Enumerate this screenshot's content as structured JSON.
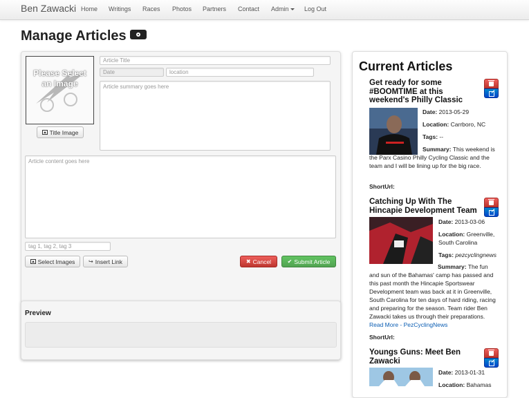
{
  "nav": {
    "brand": "Ben Zawacki",
    "items": [
      "Home",
      "Writings",
      "Races",
      "Photos",
      "Partners",
      "Contact",
      "Admin",
      "Log Out"
    ]
  },
  "page": {
    "title": "Manage Articles"
  },
  "form": {
    "title_image_text": "Please Select an Image",
    "title_image_button": "Title Image",
    "article_title_placeholder": "Article Title",
    "date_placeholder": "Date",
    "location_placeholder": "location",
    "summary_placeholder": "Article summary goes here",
    "content_placeholder": "Article content goes here",
    "tags_placeholder": "tag 1, tag 2, tag 3",
    "select_images": "Select Images",
    "insert_link": "Insert Link",
    "cancel": "Cancel",
    "submit": "Submit Article"
  },
  "preview": {
    "title": "Preview"
  },
  "current": {
    "title": "Current Articles",
    "articles": [
      {
        "title": "Get ready for some #BOOMTIME at this weekend's Philly Classic",
        "date_label": "Date:",
        "date": "2013-05-29",
        "location_label": "Location:",
        "location": "Carrboro, NC",
        "tags_label": "Tags:",
        "tags": "--",
        "summary_label": "Summary:",
        "summary": "This weekend is the Parx Casino Philly Cycling Classic and the team and I will be lining up for the big race.",
        "shorturl_label": "ShortUrl:"
      },
      {
        "title": "Catching Up With The Hincapie Development Team",
        "date_label": "Date:",
        "date": "2013-03-06",
        "location_label": "Location:",
        "location": "Greenville, South Carolina",
        "tags_label": "Tags:",
        "tags": "pezcyclingnews",
        "summary_label": "Summary:",
        "summary": "The fun and sun of the Bahamas' camp has passed and this past month the Hincapie Sportswear Development team was back at it in Greenville, South Carolina for ten days of hard riding, racing and preparing for the season. Team rider Ben Zawacki takes us through their preparations.",
        "read_more": "Read More - PezCyclingNews",
        "shorturl_label": "ShortUrl:"
      },
      {
        "title": "Youngs Guns: Meet Ben Zawacki",
        "date_label": "Date:",
        "date": "2013-01-31",
        "location_label": "Location:",
        "location": "Bahamas"
      }
    ]
  },
  "colors": {
    "danger": "#d9534f",
    "success": "#5cb85c",
    "primary": "#0055cc",
    "link": "#0a5db3"
  }
}
